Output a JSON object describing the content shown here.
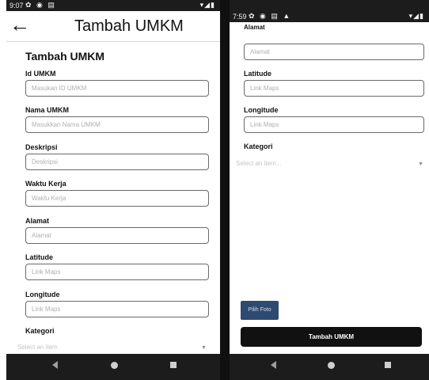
{
  "left": {
    "status": {
      "time": "9:07"
    },
    "appbar": {
      "title": "Tambah UMKM"
    },
    "form": {
      "title": "Tambah UMKM",
      "fields": [
        {
          "label": "Id UMKM",
          "placeholder": "Masukan ID UMKM"
        },
        {
          "label": "Nama UMKM",
          "placeholder": "Masukkan Nama UMKM"
        },
        {
          "label": "Deskripsi",
          "placeholder": "Deskripsi"
        },
        {
          "label": "Waktu Kerja",
          "placeholder": "Waktu Kerja"
        },
        {
          "label": "Alamat",
          "placeholder": "Alamat"
        },
        {
          "label": "Latitude",
          "placeholder": "Link Maps"
        },
        {
          "label": "Longitude",
          "placeholder": "Link Maps"
        }
      ],
      "kategori": {
        "label": "Kategori",
        "placeholder": "Select an item"
      }
    }
  },
  "right": {
    "status": {
      "time": "7:59"
    },
    "form": {
      "fields": [
        {
          "label": "Alamat",
          "placeholder": "Alamat"
        },
        {
          "label": "Latitude",
          "placeholder": "Link Maps"
        },
        {
          "label": "Longitude",
          "placeholder": "Link Maps"
        }
      ],
      "kategori": {
        "label": "Kategori",
        "placeholder": "Select an item..."
      }
    },
    "buttons": {
      "pilih_foto": "Pilih Foto",
      "submit": "Tambah UMKM"
    }
  },
  "icons": {
    "back": "arrow-left-icon",
    "dropdown": "caret-down-icon",
    "nav_back": "triangle-left-icon",
    "nav_home": "circle-icon",
    "nav_recent": "square-icon"
  }
}
